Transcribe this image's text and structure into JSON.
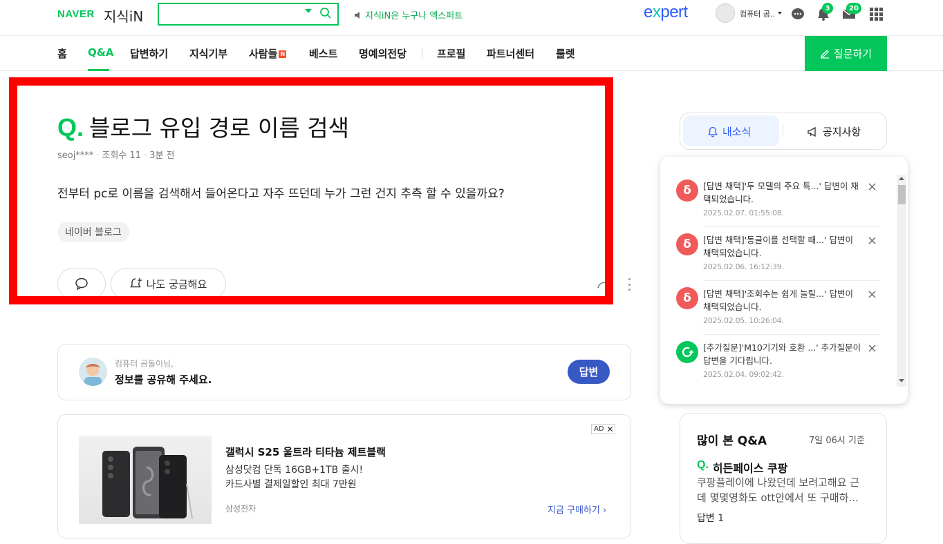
{
  "header": {
    "logo_naver": "NAVER",
    "logo_service": "지식iN",
    "search": {
      "value": "",
      "placeholder": ""
    },
    "notice_text": "지식iN은 누구나 엑스퍼트",
    "expert_logo_pre": "e",
    "expert_logo_x": "x",
    "expert_logo_post": "pert",
    "user_name": "컴퓨터 곰..",
    "notification_count": "3",
    "mail_count": "20",
    "icons": [
      "search-icon",
      "speaker-icon",
      "chat-icon",
      "bell-icon",
      "mail-icon",
      "grid-icon"
    ]
  },
  "nav": {
    "items": [
      "홈",
      "Q&A",
      "답변하기",
      "지식기부",
      "사람들",
      "베스트",
      "명예의전당",
      "프로필",
      "파트너센터",
      "룰렛"
    ],
    "new_badge": "N",
    "active": "Q&A",
    "ask_button": "질문하기"
  },
  "question": {
    "q_mark": "Q.",
    "title": "블로그 유입 경로 이름 검색",
    "author": "seoj****",
    "views": "조회수 11",
    "time": "3분 전",
    "body": "전부터 pc로 이름을 검색해서 들어온다고 자주 뜨던데 누가 그런 건지 추측 할 수 있을까요?",
    "tag": "네이버 블로그",
    "curious_label": "나도 궁금해요"
  },
  "answer_prompt": {
    "user": "컴퓨터 곰돌이님,",
    "message": "정보를 공유해 주세요.",
    "button": "답변"
  },
  "ad": {
    "tag": "AD",
    "title": "갤럭시 S25 울트라 티타늄 제트블랙",
    "line1": "삼성닷컴 단독 16GB+1TB 출시!",
    "line2": "카드사별 결제일할인 최대 7만원",
    "brand": "삼성전자",
    "cta": "지금 구매하기"
  },
  "tabs": {
    "my_news": "내소식",
    "notices": "공지사항"
  },
  "notifications": [
    {
      "icon": "adopt-icon",
      "text": "[답변 채택]'두 모델의 주요 특...' 답변이 채택되었습니다.",
      "date": "2025.02.07. 01:55:08."
    },
    {
      "icon": "adopt-icon",
      "text": "[답변 채택]'동글이를 선택할 때...' 답변이 채택되었습니다.",
      "date": "2025.02.06. 16:12:39."
    },
    {
      "icon": "adopt-icon",
      "text": "[답변 채택]'조회수는 쉽게 늘릴...' 답변이 채택되었습니다.",
      "date": "2025.02.05. 10:26:04."
    },
    {
      "icon": "add-question-icon",
      "text": "[추가질문]'M10기기와 호환 ...' 추가질문이 답변을 기다립니다.",
      "date": "2025.02.04. 09:02:42."
    }
  ],
  "popular": {
    "title": "많이 본 Q&A",
    "time": "7일 06시 기준",
    "q_mark": "Q.",
    "question": "히든페이스 쿠팡",
    "desc_line1": "쿠팡플레이에 나왔던데 보려고해요 근",
    "desc_line2": "데 몇몇영화도 ott안에서 또 구매하...",
    "answers": "답변 1"
  },
  "colors": {
    "brand_green": "#03c75a",
    "answer_blue": "#3858c4",
    "expert_blue": "#2e5cff",
    "highlight_red": "#ff0000",
    "adopt_red": "#f05a5a"
  }
}
